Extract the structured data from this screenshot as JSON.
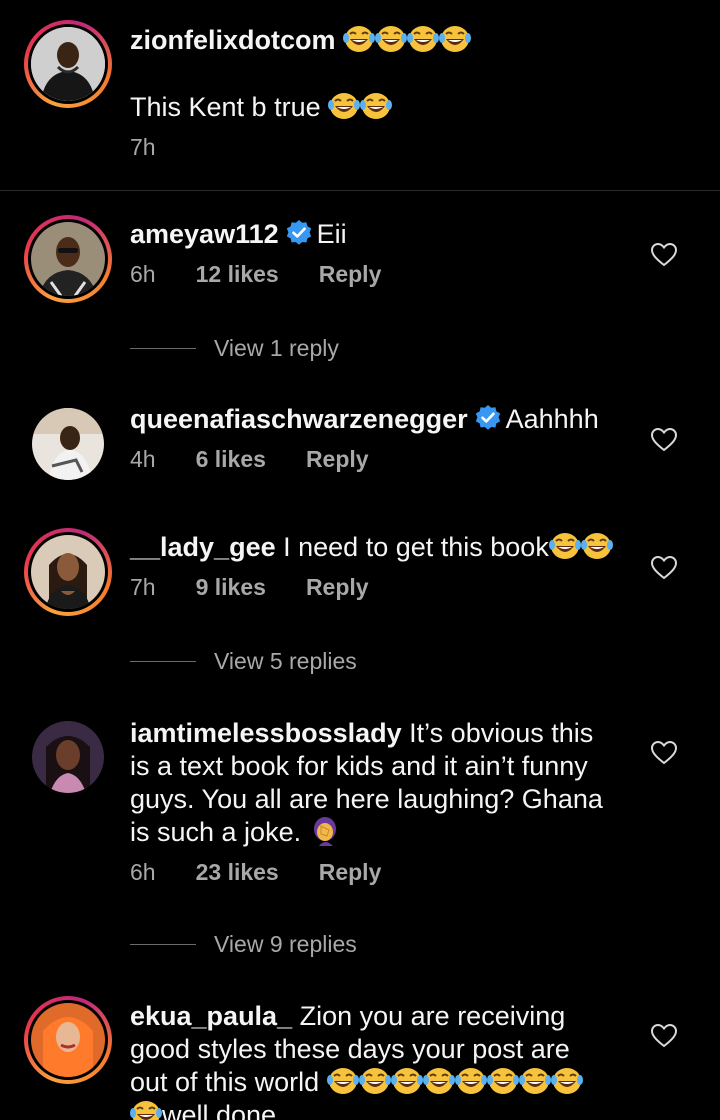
{
  "comments": [
    {
      "username": "zionfelixdotcom",
      "text": "This Kent b true",
      "time": "7h",
      "avatar": "person-in-black-hoodie"
    },
    {
      "username": "ameyaw112",
      "verified": true,
      "text": "Eii",
      "time": "6h",
      "likes": "12 likes",
      "reply_label": "Reply",
      "view_replies": "View 1 reply"
    },
    {
      "username": "queenafiaschwarzenegger",
      "verified": true,
      "text": "Aahhhh",
      "time": "4h",
      "likes": "6 likes",
      "reply_label": "Reply"
    },
    {
      "username": "__lady_gee",
      "text": "I need to get this book",
      "time": "7h",
      "likes": "9 likes",
      "reply_label": "Reply",
      "view_replies": "View 5 replies"
    },
    {
      "username": "iamtimelessbosslady",
      "text_line1": "It’s obvious this",
      "text_line2": "is a text book for kids and it ain’t funny",
      "text_line3": "guys. You all are here laughing? Ghana",
      "text_line4": "is such a joke.",
      "time": "6h",
      "likes": "23 likes",
      "reply_label": "Reply",
      "view_replies": "View 9 replies"
    },
    {
      "username": "ekua_paula_",
      "text_line1": "Zion you are receiving",
      "text_line2": "good styles these days your post are",
      "text_line3": "out of this world",
      "text_line4": "well done"
    }
  ],
  "icons": {
    "heart": "heart-outline-icon",
    "verified": "verified-badge-icon",
    "emoji_laugh": "face-with-tears-of-joy",
    "emoji_facepalm": "person-facepalming"
  },
  "colors": {
    "background": "#000000",
    "text": "#f5f5f5",
    "meta": "#a8a8a8",
    "verified": "#3897f0",
    "story_ring": "#e8364c"
  }
}
